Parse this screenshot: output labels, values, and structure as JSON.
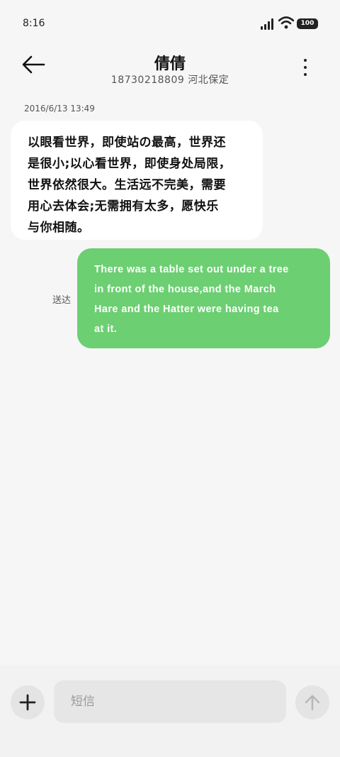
{
  "status": {
    "time": "8:16",
    "battery": "100"
  },
  "header": {
    "contact_name": "倩倩",
    "contact_detail": "18730218809 河北保定"
  },
  "conversation": {
    "timestamp": "2016/6/13 13:49",
    "messages": [
      {
        "direction": "incoming",
        "lines": [
          "以眼看世界，即使站の最高，世界还",
          "是很小;以心看世界，即使身处局限，",
          "世界依然很大。生活远不完美，需要",
          "用心去体会;无需拥有太多，愿快乐",
          "与你相随。"
        ]
      },
      {
        "direction": "outgoing",
        "lines": [
          "There was a table set out under a tree",
          "in front of the house,and the March",
          "Hare and the Hatter were having tea",
          "at it."
        ],
        "status": "送达"
      }
    ]
  },
  "compose": {
    "placeholder": "短信"
  },
  "colors": {
    "outgoing_bubble": "#6ccf72",
    "incoming_bubble": "#ffffff",
    "background": "#f6f6f6"
  }
}
